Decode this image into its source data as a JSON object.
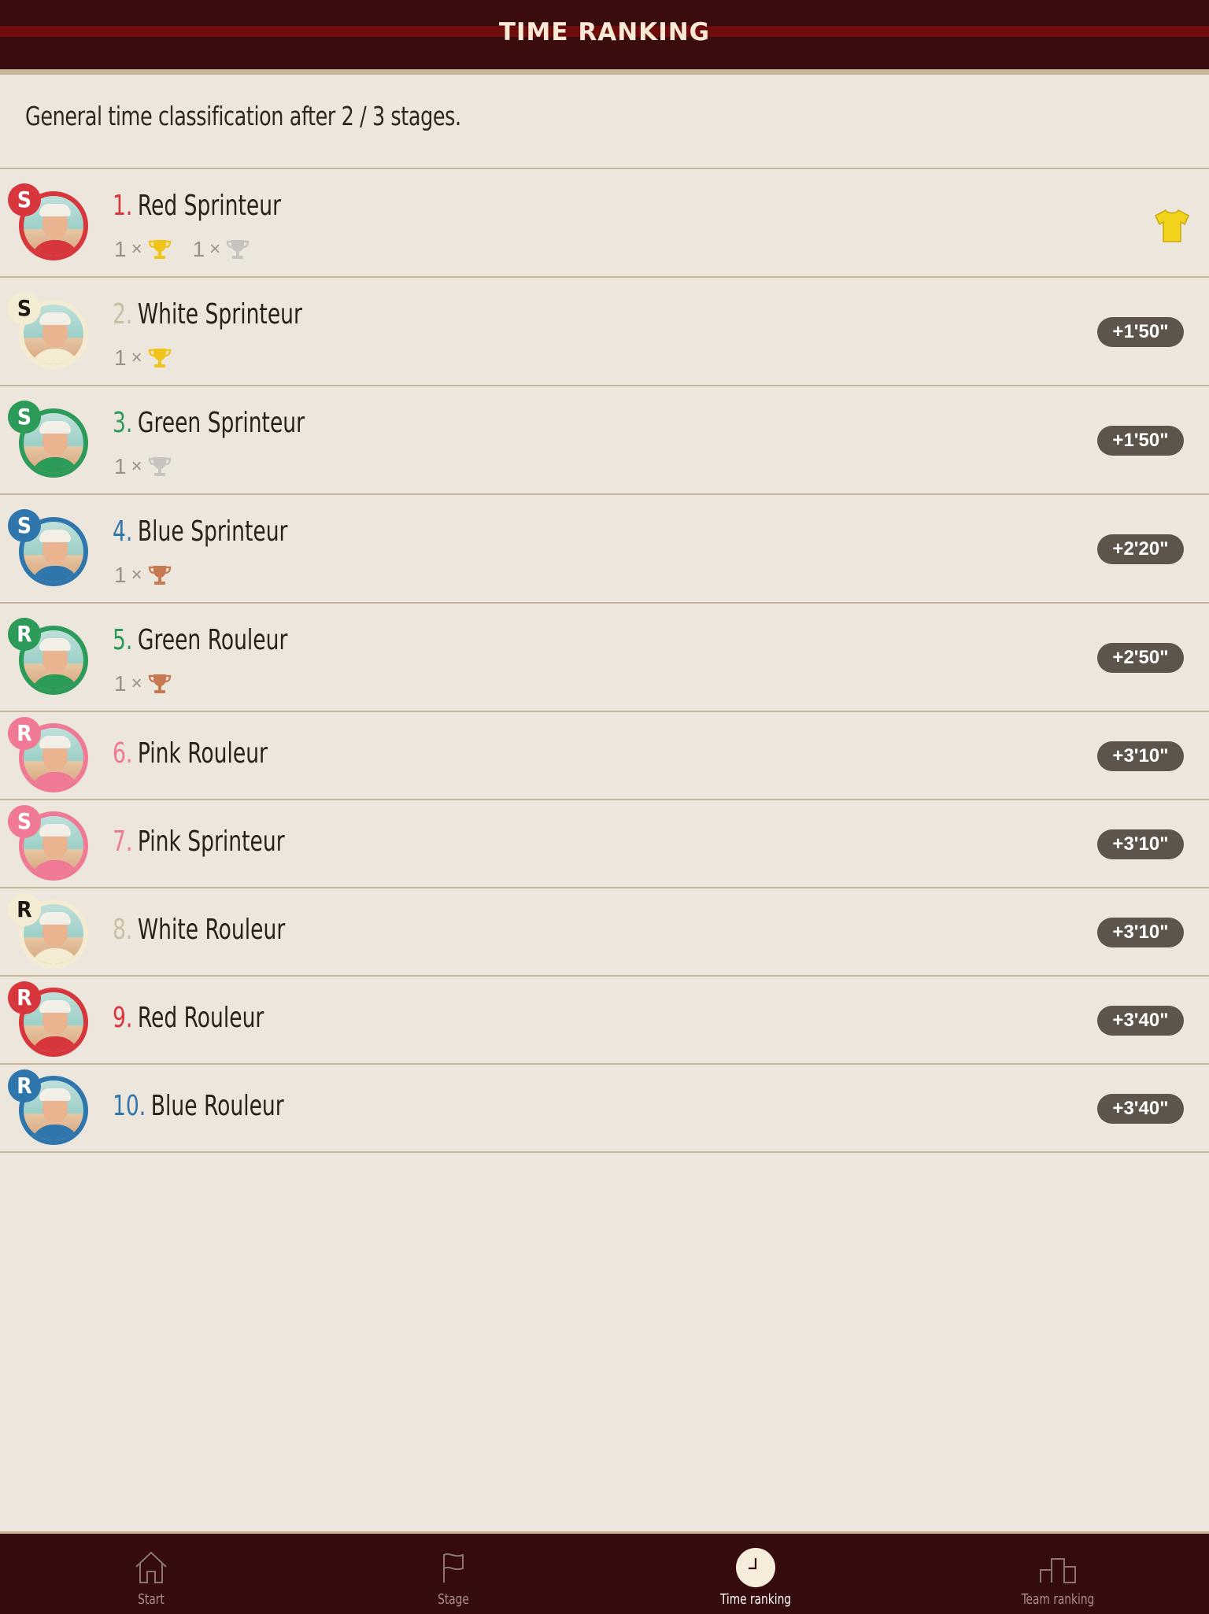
{
  "header": {
    "title": "TIME RANKING"
  },
  "subtitle": "General time classification after 2 / 3 stages.",
  "colors": {
    "red": "#d6363c",
    "white": "#f3ecd3",
    "green": "#2c9a58",
    "blue": "#2f76ad",
    "pink": "#f07a95",
    "gold": "#f0c419",
    "silver": "#c6c3c0",
    "bronze": "#c77a52",
    "pill": "#5d544b",
    "jersey": "#f1d31c"
  },
  "riders": [
    {
      "rank": "1.",
      "name": "Red Sprinteur",
      "role": "S",
      "color": "red",
      "jersey_icon": "yellow-jersey-icon",
      "trophies": [
        {
          "count": "1",
          "x": "×",
          "type": "gold"
        },
        {
          "count": "1",
          "x": "×",
          "type": "silver"
        }
      ],
      "time": ""
    },
    {
      "rank": "2.",
      "name": "White Sprinteur",
      "role": "S",
      "color": "white",
      "trophies": [
        {
          "count": "1",
          "x": "×",
          "type": "gold"
        }
      ],
      "time": "+1'50\""
    },
    {
      "rank": "3.",
      "name": "Green Sprinteur",
      "role": "S",
      "color": "green",
      "trophies": [
        {
          "count": "1",
          "x": "×",
          "type": "silver"
        }
      ],
      "time": "+1'50\""
    },
    {
      "rank": "4.",
      "name": "Blue Sprinteur",
      "role": "S",
      "color": "blue",
      "trophies": [
        {
          "count": "1",
          "x": "×",
          "type": "bronze"
        }
      ],
      "time": "+2'20\""
    },
    {
      "rank": "5.",
      "name": "Green Rouleur",
      "role": "R",
      "color": "green",
      "trophies": [
        {
          "count": "1",
          "x": "×",
          "type": "bronze"
        }
      ],
      "time": "+2'50\""
    },
    {
      "rank": "6.",
      "name": "Pink Rouleur",
      "role": "R",
      "color": "pink",
      "trophies": [],
      "time": "+3'10\""
    },
    {
      "rank": "7.",
      "name": "Pink Sprinteur",
      "role": "S",
      "color": "pink",
      "trophies": [],
      "time": "+3'10\""
    },
    {
      "rank": "8.",
      "name": "White Rouleur",
      "role": "R",
      "color": "white",
      "trophies": [],
      "time": "+3'10\""
    },
    {
      "rank": "9.",
      "name": "Red Rouleur",
      "role": "R",
      "color": "red",
      "trophies": [],
      "time": "+3'40\""
    },
    {
      "rank": "10.",
      "name": "Blue Rouleur",
      "role": "R",
      "color": "blue",
      "trophies": [],
      "time": "+3'40\""
    }
  ],
  "tabs": [
    {
      "label": "Start",
      "icon": "home-icon",
      "active": false
    },
    {
      "label": "Stage",
      "icon": "flag-icon",
      "active": false
    },
    {
      "label": "Time ranking",
      "icon": "clock-icon",
      "active": true
    },
    {
      "label": "Team ranking",
      "icon": "podium-icon",
      "active": false
    }
  ]
}
